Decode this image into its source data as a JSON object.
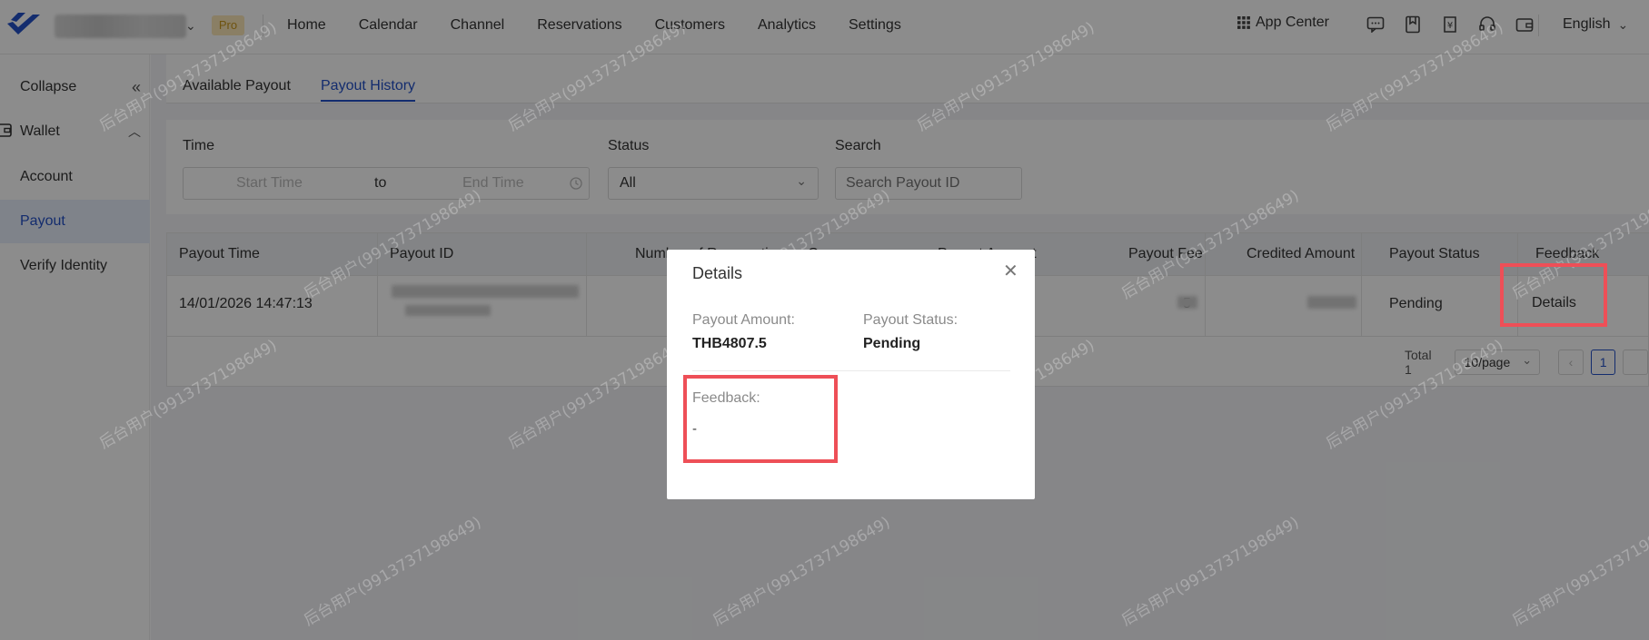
{
  "header": {
    "pro_badge": "Pro",
    "nav": [
      "Home",
      "Calendar",
      "Channel",
      "Reservations",
      "Customers",
      "Analytics",
      "Settings"
    ],
    "app_center": "App Center",
    "language": "English"
  },
  "sidebar": {
    "collapse": "Collapse",
    "wallet": "Wallet",
    "items": [
      "Account",
      "Payout",
      "Verify Identity"
    ]
  },
  "tabs": [
    "Available Payout",
    "Payout History"
  ],
  "filters": {
    "time_label": "Time",
    "start_placeholder": "Start Time",
    "to": "to",
    "end_placeholder": "End Time",
    "status_label": "Status",
    "status_value": "All",
    "search_label": "Search",
    "search_placeholder": "Search Payout ID"
  },
  "table": {
    "headers": [
      "Payout Time",
      "Payout ID",
      "Number of Reservations",
      "Currency",
      "Payout Amount",
      "Payout Fee",
      "Credited Amount",
      "Payout Status",
      "Feedback"
    ],
    "row": {
      "payout_time": "14/01/2026 14:47:13",
      "amount_tail": "5",
      "status": "Pending",
      "details": "Details"
    },
    "total": "Total 1",
    "page_size": "10/page",
    "current_page": "1"
  },
  "modal": {
    "title": "Details",
    "amount_label": "Payout Amount:",
    "amount_value": "THB4807.5",
    "status_label": "Payout Status:",
    "status_value": "Pending",
    "feedback_label": "Feedback:",
    "feedback_value": "-"
  },
  "watermark": "后台用户(9913737198649)",
  "colors": {
    "accent": "#2451c8",
    "highlight": "#ee4f57",
    "pro": "#c9971c"
  }
}
